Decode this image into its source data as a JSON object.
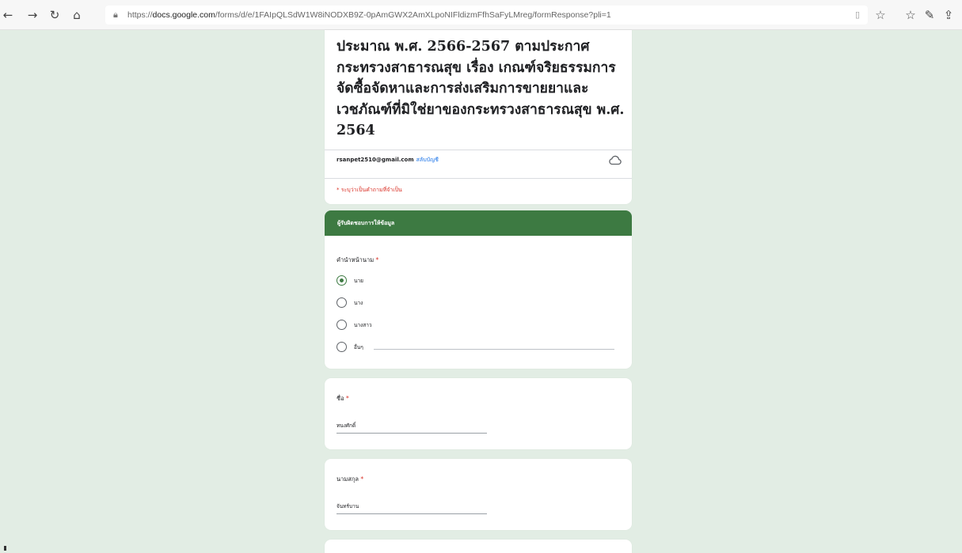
{
  "browser": {
    "url_prefix": "https://",
    "url_host": "docs.google.com",
    "url_path": "/forms/d/e/1FAIpQLSdW1W8iNODXB9Z-0pAmGWX2AmXLpoNIFldizmFfhSaFyLMreg/formResponse?pli=1"
  },
  "form": {
    "title": "ประมาณ พ.ศ. 2566-2567 ตามประกาศกระทรวงสาธารณสุข เรื่อง เกณฑ์จริยธรรมการจัดซื้อจัดหาและการส่งเสริมการขายยาและเวชภัณฑ์ที่มิใช่ยาของกระทรวงสาธารณสุข พ.ศ. 2564",
    "account_email": "rsanpet2510@gmail.com",
    "account_switch": "สลับบัญชี",
    "required_note": "* ระบุว่าเป็นคำถามที่จำเป็น"
  },
  "section": {
    "title": "ผู้รับผิดชอบการให้ข้อมูล"
  },
  "q_prefix": {
    "label": "คำนำหน้านาม",
    "required_mark": "*",
    "options": [
      "นาย",
      "นาง",
      "นางสาว",
      "อื่นๆ"
    ],
    "selected": "นาย"
  },
  "q_firstname": {
    "label": "ชื่อ",
    "required_mark": "*",
    "value": "ทนงศักดิ์"
  },
  "q_lastname": {
    "label": "นามสกุล",
    "required_mark": "*",
    "value": "จันทร์บาน"
  },
  "colors": {
    "accent": "#3d7a42",
    "background": "#e2ede4",
    "required": "#d93025"
  }
}
